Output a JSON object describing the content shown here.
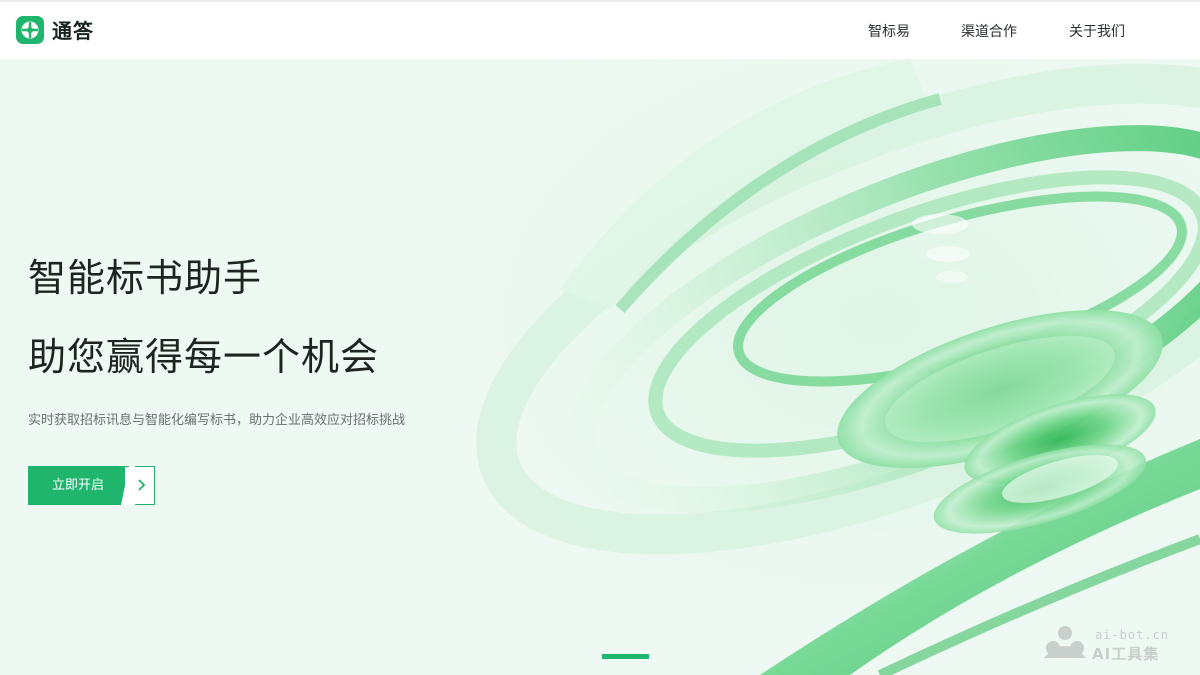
{
  "brand": {
    "name": "通答",
    "accent": "#1fb56c"
  },
  "nav": {
    "items": [
      {
        "label": "智标易"
      },
      {
        "label": "渠道合作"
      },
      {
        "label": "关于我们"
      }
    ]
  },
  "hero": {
    "title_line1": "智能标书助手",
    "title_line2": "助您赢得每一个机会",
    "subtitle": "实时获取招标讯息与智能化编写标书，助力企业高效应对招标挑战",
    "cta_label": "立即开启",
    "cta_icon": "chevron-right-icon"
  },
  "watermark": {
    "line1": "ai-bot.cn",
    "line2": "AI工具集"
  }
}
